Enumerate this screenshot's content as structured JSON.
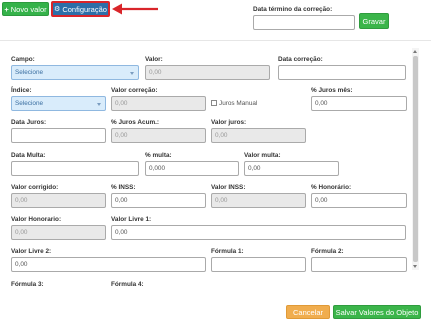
{
  "toolbar": {
    "new_label": "Novo valor",
    "config_label": "Configuração"
  },
  "header": {
    "end_date_label": "Data término da correção:",
    "save_label": "Gravar"
  },
  "form": {
    "campo_label": "Campo:",
    "campo_value": "Selecione",
    "valor_label": "Valor:",
    "valor_value": "0,00",
    "data_correcao_label": "Data correção:",
    "indice_label": "Índice:",
    "indice_value": "Selecione",
    "valor_correcao_label": "Valor correção:",
    "valor_correcao_value": "0,00",
    "juros_manual_label": "Juros Manual",
    "pct_juros_mes_label": "% Juros mês:",
    "pct_juros_mes_value": "0,00",
    "data_juros_label": "Data Juros:",
    "pct_juros_acum_label": "% Juros Acum.:",
    "pct_juros_acum_value": "0,00",
    "valor_juros_label": "Valor juros:",
    "valor_juros_value": "0,00",
    "data_multa_label": "Data Multa:",
    "pct_multa_label": "% multa:",
    "pct_multa_value": "0,000",
    "valor_multa_label": "Valor multa:",
    "valor_multa_value": "0,00",
    "valor_corrigido_label": "Valor corrigido:",
    "valor_corrigido_value": "0,00",
    "pct_inss_label": "% INSS:",
    "pct_inss_value": "0,00",
    "valor_inss_label": "Valor INSS:",
    "valor_inss_value": "0,00",
    "pct_honorario_label": "% Honorário:",
    "pct_honorario_value": "0,00",
    "valor_honorario_label": "Valor Honorario:",
    "valor_honorario_value": "0,00",
    "valor_livre1_label": "Valor Livre 1:",
    "valor_livre1_value": "0,00",
    "valor_livre2_label": "Valor Livre 2:",
    "valor_livre2_value": "0,00",
    "formula1_label": "Fórmula 1:",
    "formula2_label": "Fórmula 2:",
    "formula3_label": "Fórmula 3:",
    "formula4_label": "Fórmula 4:"
  },
  "footer": {
    "cancel_label": "Cancelar",
    "save_values_label": "Salvar Valores do Objeto"
  },
  "colors": {
    "green": "#35b24a",
    "blue": "#2c6ea8",
    "orange": "#f0ad4e",
    "highlight_red": "#d9252a"
  },
  "icons": {
    "new": "plus-icon",
    "config": "gear-icon"
  }
}
